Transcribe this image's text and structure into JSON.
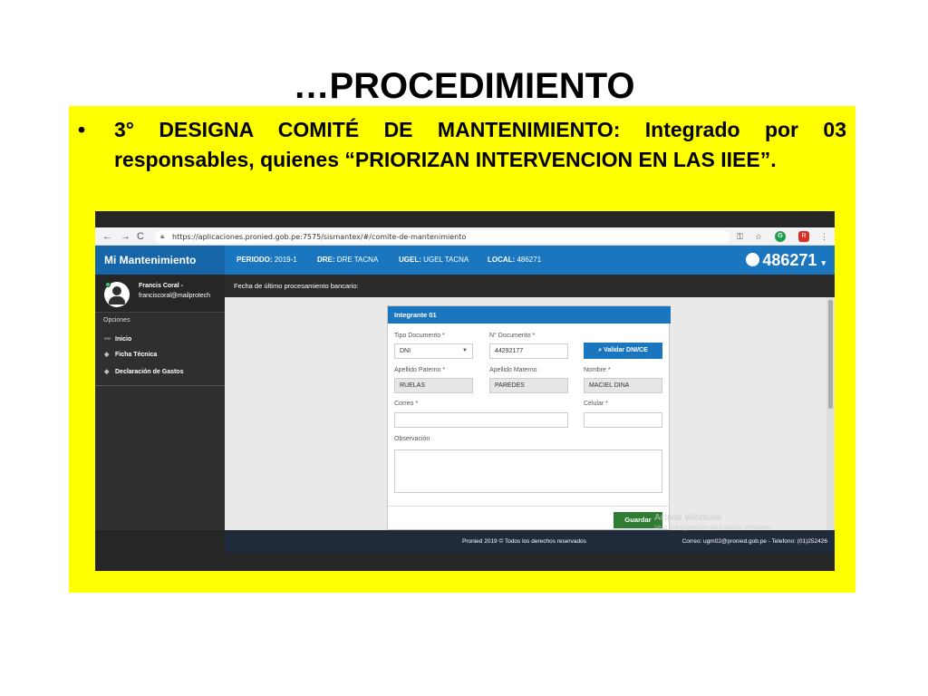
{
  "slide": {
    "title": "…PROCEDIMIENTO",
    "bullet": "3° DESIGNA COMITÉ DE MANTENIMIENTO: Integrado por 03 responsables, quienes “PRIORIZAN INTERVENCION EN LAS IIEE”."
  },
  "browser": {
    "url": "https://aplicaciones.pronied.gob.pe:7575/sismantex/#/comite-de-mantenimiento",
    "profile_initial": "R"
  },
  "app": {
    "brand": "Mi Mantenimiento",
    "periodo_label": "PERIODO:",
    "periodo_value": "2019-1",
    "dre_label": "DRE:",
    "dre_value": "DRE TACNA",
    "ugel_label": "UGEL:",
    "ugel_value": "UGEL TACNA",
    "local_label": "LOCAL:",
    "local_value": "486271",
    "user_code": "486271"
  },
  "sidebar": {
    "user_name": "Francis Coral -",
    "user_email": "franciscoral@mailprotech",
    "section_label": "Opciones",
    "items": [
      {
        "label": "Inicio",
        "icon": "chart-line-icon"
      },
      {
        "label": "Ficha Técnica",
        "icon": "layers-icon"
      },
      {
        "label": "Declaración de Gastos",
        "icon": "layers-icon"
      }
    ]
  },
  "content": {
    "bar_text": "Fecha de último procesamiento bancario:"
  },
  "form": {
    "header": "Integrante 01",
    "tipo_doc_label": "Tipo Documento *",
    "tipo_doc_value": "DNI",
    "num_doc_label": "N° Documento *",
    "num_doc_value": "44292177",
    "validar_label": "Validar DNI/CE",
    "ap_paterno_label": "Apellido Paterno *",
    "ap_paterno_value": "RUELAS",
    "ap_materno_label": "Apellido Materno",
    "ap_materno_value": "PAREDES",
    "nombre_label": "Nombre *",
    "nombre_value": "MACIEL DINA",
    "correo_label": "Correo *",
    "correo_value": "",
    "celular_label": "Celular *",
    "celular_value": "",
    "observacion_label": "Observación",
    "guardar_label": "Guardar"
  },
  "footer": {
    "left": "Pronied 2019 © Todos los derechos reservados",
    "right": "Correo: ugm02@pronied.gob.pe - Telefono: (01)252426"
  },
  "watermark": {
    "line1": "Activar Windows",
    "line2": "Ve a Configuración para activar Windows."
  }
}
